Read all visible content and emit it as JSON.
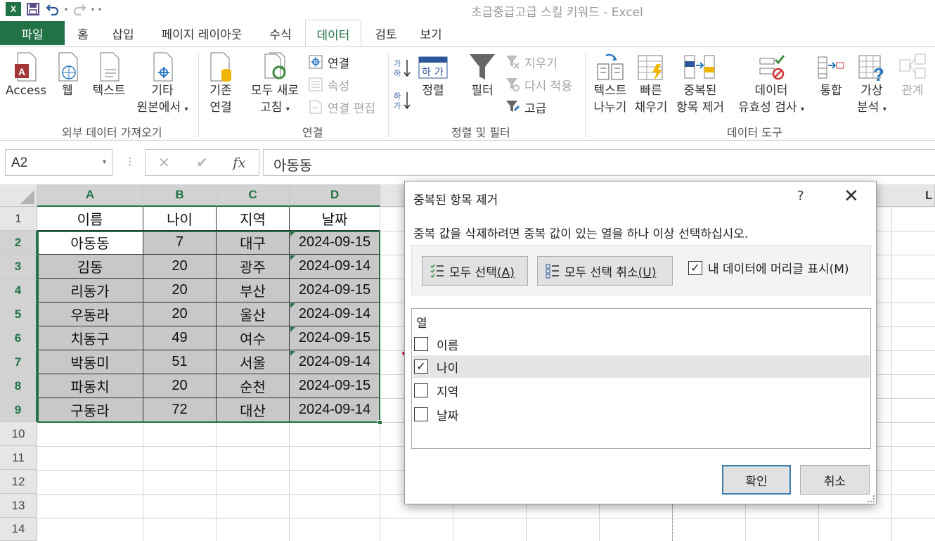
{
  "window": {
    "title": "초급중급고급 스킬 키워드 - Excel",
    "app_badge": "X"
  },
  "tabs": [
    {
      "label": "파일"
    },
    {
      "label": "홈"
    },
    {
      "label": "삽입"
    },
    {
      "label": "페이지 레이아웃"
    },
    {
      "label": "수식"
    },
    {
      "label": "데이터"
    },
    {
      "label": "검토"
    },
    {
      "label": "보기"
    }
  ],
  "ribbon": {
    "external": {
      "access": "Access",
      "web": "웹",
      "text": "텍스트",
      "other1": "기타",
      "other2": "원본에서",
      "group": "외부 데이터 가져오기"
    },
    "connections": {
      "existing1": "기존",
      "existing2": "연결",
      "refresh1": "모두 새로",
      "refresh2": "고침",
      "conn": "연결",
      "props": "속성",
      "edit_links": "연결 편집",
      "group": "연결"
    },
    "sort": {
      "sort": "정렬",
      "filter": "필터",
      "clear": "지우기",
      "reapply": "다시 적용",
      "advanced": "고급",
      "group": "정렬 및 필터"
    },
    "tools": {
      "t2c1": "텍스트",
      "t2c2": "나누기",
      "flash1": "빠른",
      "flash2": "채우기",
      "dup1": "중복된",
      "dup2": "항목 제거",
      "valid1": "데이터",
      "valid2": "유효성 검사",
      "consol": "통합",
      "whatif1": "가상",
      "whatif2": "분석",
      "rel": "관계",
      "group": "데이터 도구"
    }
  },
  "formula_bar": {
    "name_box": "A2",
    "fx": "fx",
    "value": "아동동",
    "cancel": "✕",
    "enter": "✔"
  },
  "sheet": {
    "columns": [
      "A",
      "B",
      "C",
      "D"
    ],
    "next_col_letter": "L",
    "rows": [
      "1",
      "2",
      "3",
      "4",
      "5",
      "6",
      "7",
      "8",
      "9",
      "10",
      "11",
      "12",
      "13",
      "14"
    ],
    "header": [
      "이름",
      "나이",
      "지역",
      "날짜"
    ],
    "data": [
      [
        "아동동",
        "7",
        "대구",
        "2024-09-15"
      ],
      [
        "김동",
        "20",
        "광주",
        "2024-09-14"
      ],
      [
        "리동가",
        "20",
        "부산",
        "2024-09-15"
      ],
      [
        "우동라",
        "20",
        "울산",
        "2024-09-14"
      ],
      [
        "치동구",
        "49",
        "여수",
        "2024-09-15"
      ],
      [
        "박동미",
        "51",
        "서울",
        "2024-09-14"
      ],
      [
        "파동치",
        "20",
        "순천",
        "2024-09-15"
      ],
      [
        "구동라",
        "72",
        "대산",
        "2024-09-14"
      ]
    ]
  },
  "dialog": {
    "title": "중복된 항목 제거",
    "help": "?",
    "close": "✕",
    "instruction": "중복 값을 삭제하려면 중복 값이 있는 열을 하나 이상 선택하십시오.",
    "select_all_text": "모두 선택",
    "select_all_key": "(A)",
    "unselect_all_text": "모두 선택 취소",
    "unselect_all_key": "(U)",
    "headers_text": "내 데이터에 머리글 표시",
    "headers_key": "(M)",
    "headers_checked": true,
    "list_header": "열",
    "columns": [
      {
        "label": "이름",
        "checked": false
      },
      {
        "label": "나이",
        "checked": true
      },
      {
        "label": "지역",
        "checked": false
      },
      {
        "label": "날짜",
        "checked": false
      }
    ],
    "ok": "확인",
    "cancel": "취소"
  },
  "colors": {
    "excel_green": "#217346",
    "selected_fill": "#c8c8c8",
    "annotation_red": "#d4001a"
  }
}
